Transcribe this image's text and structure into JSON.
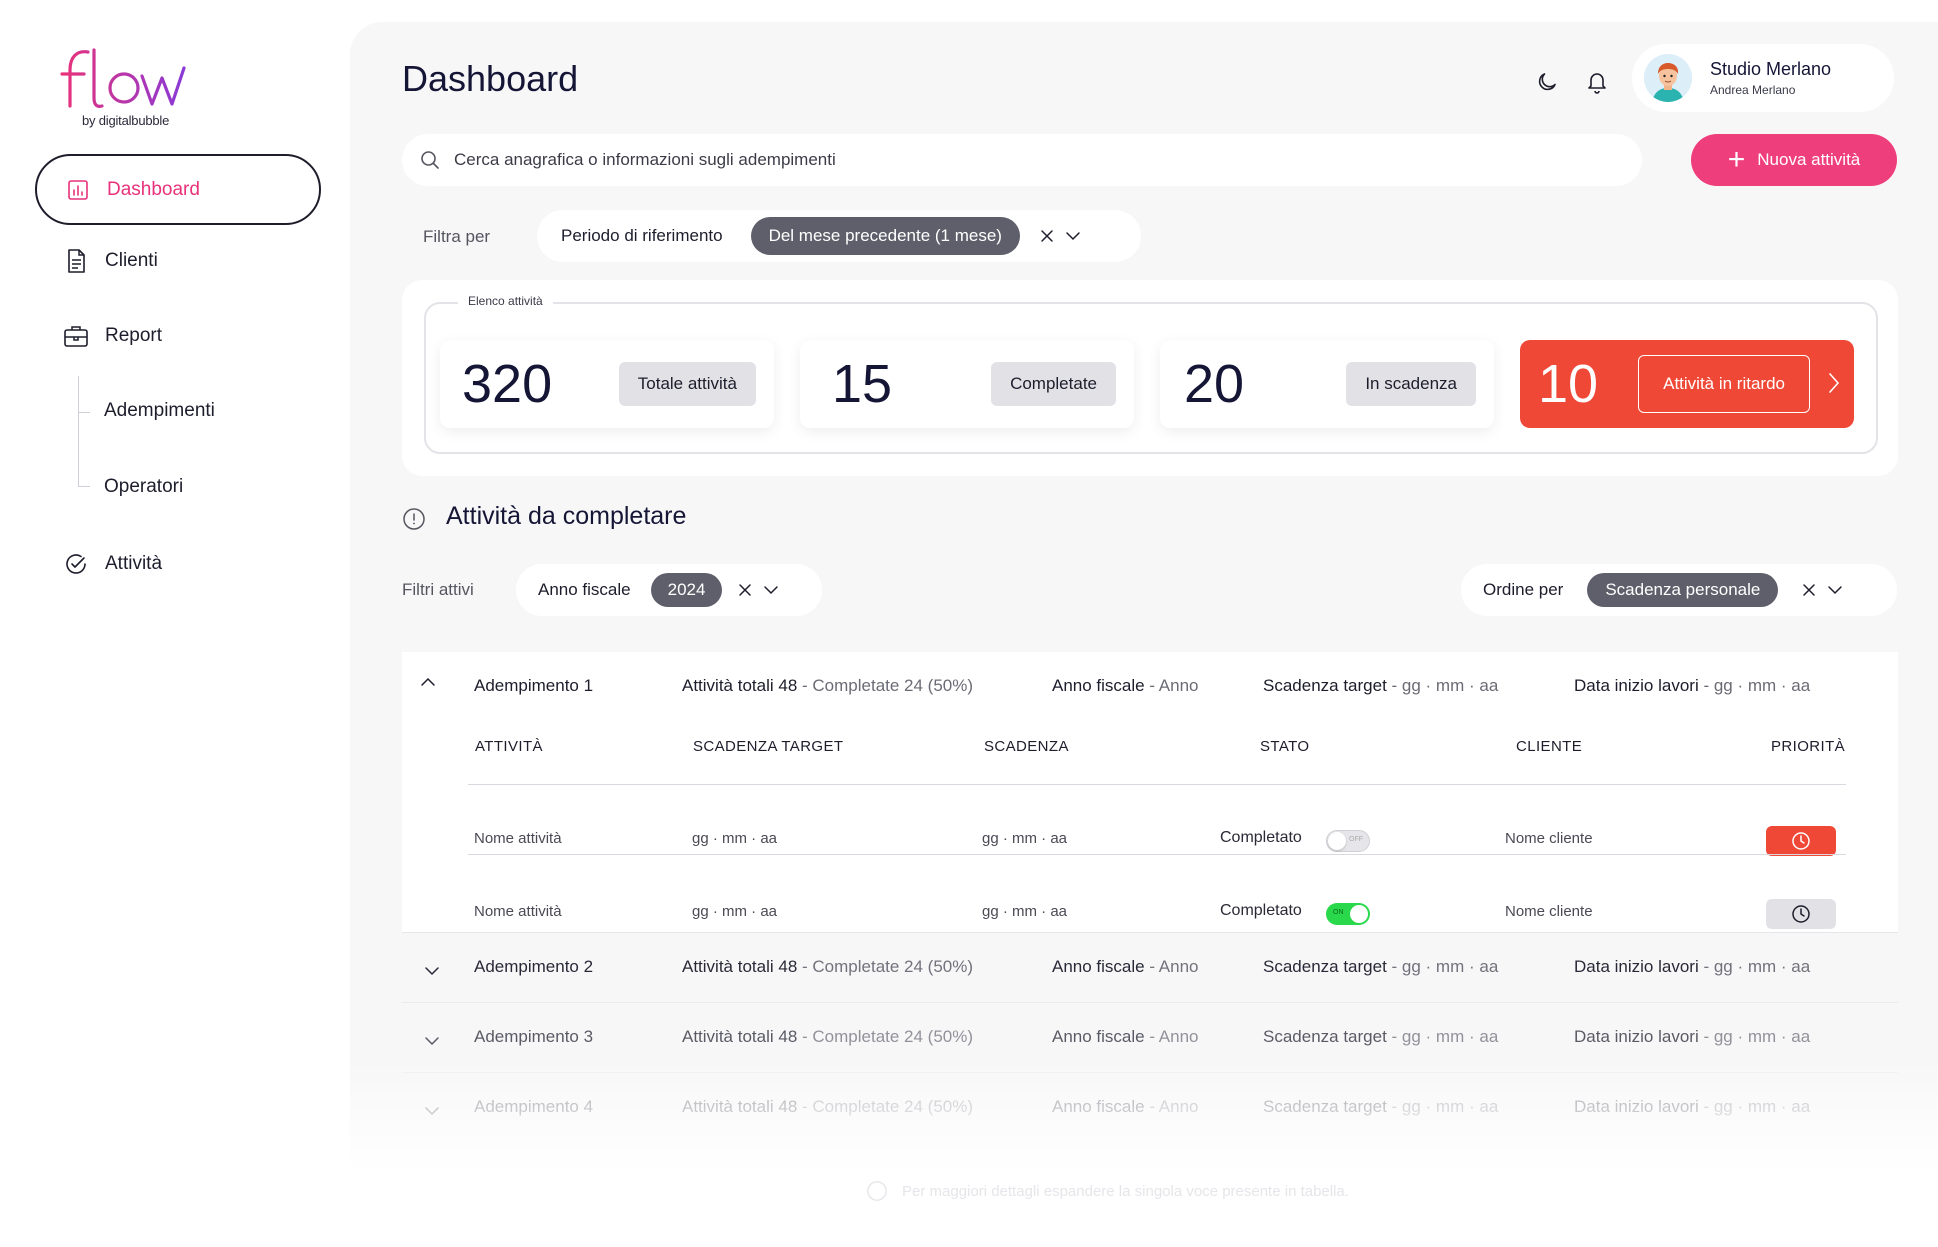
{
  "brand": {
    "logo_text": "flow",
    "subtitle": "by digitalbubble",
    "accent": "#e8327a"
  },
  "sidebar": {
    "items": [
      {
        "label": "Dashboard",
        "icon": "chart-icon",
        "active": true
      },
      {
        "label": "Clienti",
        "icon": "document-icon"
      },
      {
        "label": "Report",
        "icon": "briefcase-icon"
      },
      {
        "label": "Attività",
        "icon": "check-circle-icon"
      }
    ],
    "subitems": [
      {
        "label": "Adempimenti"
      },
      {
        "label": "Operatori"
      }
    ]
  },
  "header": {
    "title": "Dashboard",
    "user": {
      "name": "Studio Merlano",
      "subtitle": "Andrea Merlano"
    }
  },
  "search": {
    "placeholder": "Cerca anagrafica o informazioni sugli adempimenti"
  },
  "new_button": {
    "label": "Nuova attività",
    "color": "#ee3f7c"
  },
  "filter": {
    "label": "Filtra per",
    "name": "Periodo  di riferimento",
    "value": "Del mese precedente (1 mese)"
  },
  "stats": {
    "legend": "Elenco attività",
    "cards": [
      {
        "value": "320",
        "label": "Totale attività"
      },
      {
        "value": "15",
        "label": "Completate"
      },
      {
        "value": "20",
        "label": "In scadenza"
      },
      {
        "value": "10",
        "label": "Attività in ritardo",
        "color": "#ef4836"
      }
    ]
  },
  "section": {
    "title": "Attività da completare"
  },
  "active_filters": {
    "label": "Filtri attivi",
    "name": "Anno fiscale",
    "value": "2024"
  },
  "order": {
    "label": "Ordine per",
    "value": "Scadenza personale"
  },
  "table": {
    "columns": [
      "ATTIVITÀ",
      "SCADENZA TARGET",
      "SCADENZA",
      "STATO",
      "CLIENTE",
      "PRIORITÀ"
    ],
    "group_summary": {
      "totals": "Attività totali 48",
      "completed": " - Completate 24 (50%)",
      "fiscal_label": "Anno fiscale",
      "fiscal_value": " - Anno",
      "target_label": "Scadenza target",
      "target_value": " - gg · mm · aa",
      "start_label": "Data inizio lavori",
      "start_value": " - gg · mm · aa"
    },
    "groups": [
      {
        "name": "Adempimento 1",
        "expanded": true
      },
      {
        "name": "Adempimento 2"
      },
      {
        "name": "Adempimento 3"
      },
      {
        "name": "Adempimento 4"
      }
    ],
    "rows": [
      {
        "activity": "Nome attività",
        "target": "gg · mm · aa",
        "deadline": "gg · mm · aa",
        "status": "Completato",
        "toggle": "off",
        "toggle_label": "OFF",
        "client": "Nome cliente",
        "priority": "high",
        "priority_color": "#ef4836"
      },
      {
        "activity": "Nome attività",
        "target": "gg · mm · aa",
        "deadline": "gg · mm · aa",
        "status": "Completato",
        "toggle": "on",
        "toggle_label": "ON",
        "client": "Nome cliente",
        "priority": "normal",
        "priority_color": "#e2e2e6"
      }
    ]
  },
  "footer_note": "Per maggiori dettagli espandere la singola voce presente in tabella."
}
